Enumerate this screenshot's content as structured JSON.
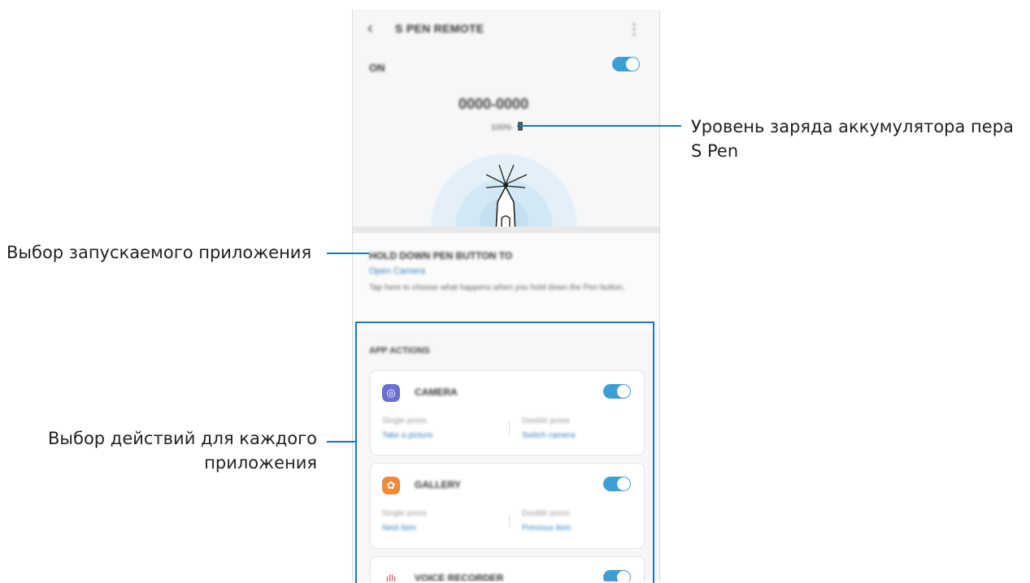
{
  "callouts": {
    "battery_level": [
      "Уровень заряда аккумулятора пера",
      "S Pen"
    ],
    "select_app": "Выбор запускаемого приложения",
    "select_actions": [
      "Выбор действий для каждого",
      "приложения"
    ]
  },
  "phone": {
    "header": {
      "title": "S PEN REMOTE"
    },
    "on_label": "ON",
    "pen_name": "0000-0000",
    "battery_percent": "100%",
    "hold_section": {
      "title": "HOLD DOWN PEN BUTTON TO",
      "link": "Open Camera",
      "description": "Tap here to choose what happens when you hold down the Pen button."
    },
    "app_actions": {
      "title": "APP ACTIONS",
      "cards": [
        {
          "name": "CAMERA",
          "icon": "camera-icon",
          "icon_color": "#6b6fd1",
          "single_label": "Single press",
          "single_action": "Take a picture",
          "double_label": "Double press",
          "double_action": "Switch camera"
        },
        {
          "name": "GALLERY",
          "icon": "gallery-icon",
          "icon_color": "#f08a3c",
          "single_label": "Single press",
          "single_action": "Next item",
          "double_label": "Double press",
          "double_action": "Previous item"
        },
        {
          "name": "VOICE RECORDER",
          "icon": "voice-recorder-icon",
          "icon_color": "#e24b4b"
        }
      ]
    }
  },
  "colors": {
    "accent": "#1e78b4",
    "toggle_on": "#3d9ed6"
  }
}
